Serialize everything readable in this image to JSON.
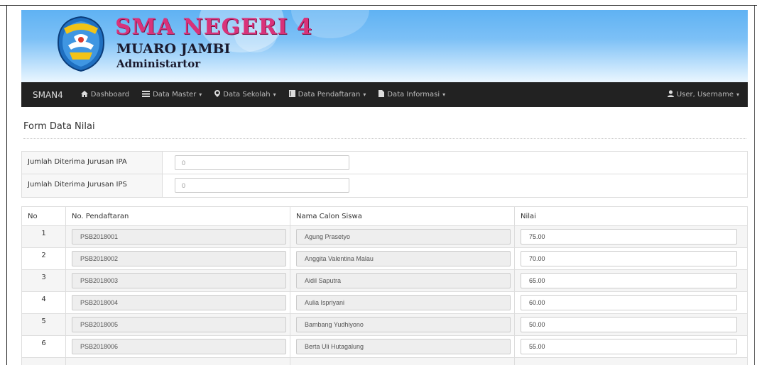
{
  "header": {
    "title": "SMA NEGERI 4",
    "subtitle": "MUARO JAMBI",
    "role": "Administartor"
  },
  "navbar": {
    "brand": "SMAN4",
    "items": [
      {
        "label": "Dashboard",
        "icon": "home-icon",
        "dropdown": false
      },
      {
        "label": "Data Master",
        "icon": "list-icon",
        "dropdown": true
      },
      {
        "label": "Data Sekolah",
        "icon": "map-marker-icon",
        "dropdown": true
      },
      {
        "label": "Data Pendaftaran",
        "icon": "book-icon",
        "dropdown": true
      },
      {
        "label": "Data Informasi",
        "icon": "file-icon",
        "dropdown": true
      }
    ],
    "user_label": "User, Username"
  },
  "form": {
    "title": "Form Data Nilai",
    "summary": [
      {
        "label": "Jumlah Diterima Jurusan IPA",
        "value": "0"
      },
      {
        "label": "Jumlah Diterima Jurusan IPS",
        "value": "0"
      }
    ]
  },
  "table": {
    "headers": [
      "No",
      "No. Pendaftaran",
      "Nama Calon Siswa",
      "Nilai"
    ],
    "rows": [
      {
        "no": "1",
        "pendaftaran": "PSB2018001",
        "nama": "Agung Prasetyo",
        "nilai": "75.00"
      },
      {
        "no": "2",
        "pendaftaran": "PSB2018002",
        "nama": "Anggita Valentina Malau",
        "nilai": "70.00"
      },
      {
        "no": "3",
        "pendaftaran": "PSB2018003",
        "nama": "Aidil Saputra",
        "nilai": "65.00"
      },
      {
        "no": "4",
        "pendaftaran": "PSB2018004",
        "nama": "Aulia Ispriyani",
        "nilai": "60.00"
      },
      {
        "no": "5",
        "pendaftaran": "PSB2018005",
        "nama": "Bambang Yudhiyono",
        "nilai": "50.00"
      },
      {
        "no": "6",
        "pendaftaran": "PSB2018006",
        "nama": "Berta Uli Hutagalung",
        "nilai": "55.00"
      }
    ]
  },
  "colors": {
    "navbar_bg": "#222222",
    "title_pink": "#d9327a",
    "banner_blue": "#5fb2f3"
  }
}
